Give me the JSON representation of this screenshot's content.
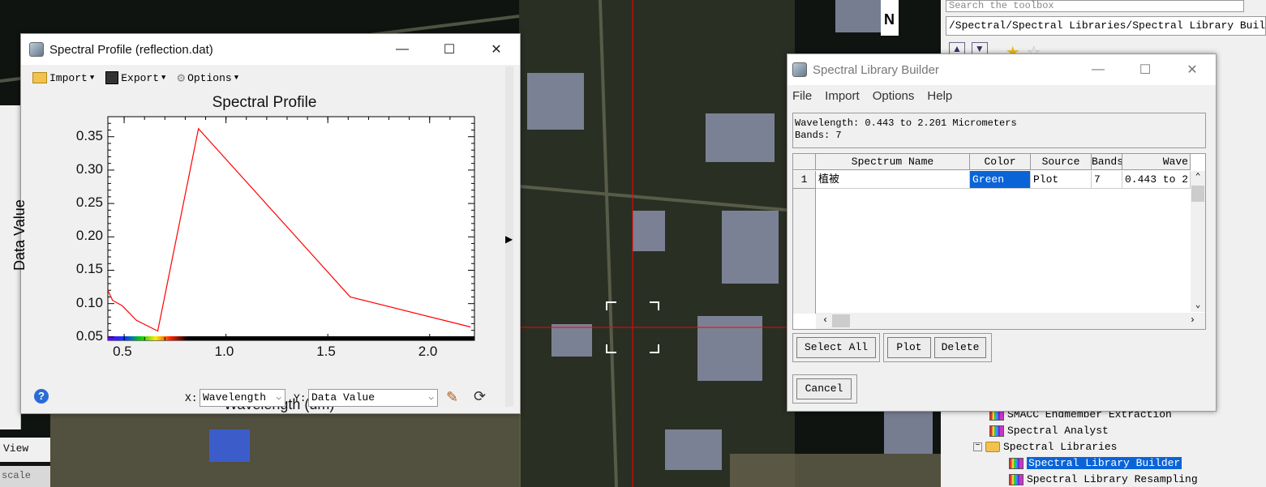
{
  "spectral_profile": {
    "title": "Spectral Profile (reflection.dat)",
    "toolbar": {
      "import": "Import",
      "export": "Export",
      "options": "Options"
    },
    "x_select": {
      "label": "X:",
      "value": "Wavelength"
    },
    "y_select": {
      "label": "Y:",
      "value": "Data Value"
    },
    "chart_data": {
      "type": "line",
      "title": "Spectral Profile",
      "xlabel": "Wavelength (um)",
      "ylabel": "Data Value",
      "xlim": [
        0.42,
        2.22
      ],
      "ylim": [
        0.045,
        0.38
      ],
      "xticks": [
        "0.5",
        "1.0",
        "1.5",
        "2.0"
      ],
      "yticks": [
        "0.05",
        "0.10",
        "0.15",
        "0.20",
        "0.25",
        "0.30",
        "0.35"
      ],
      "series": [
        {
          "color": "#ff0000",
          "x": [
            0.418,
            0.443,
            0.49,
            0.56,
            0.665,
            0.865,
            1.61,
            2.201
          ],
          "y": [
            0.12,
            0.105,
            0.097,
            0.075,
            0.059,
            0.362,
            0.11,
            0.065
          ]
        }
      ]
    }
  },
  "library_builder": {
    "title": "Spectral Library Builder",
    "menu": [
      "File",
      "Import",
      "Options",
      "Help"
    ],
    "info_line1": "Wavelength: 0.443 to 2.201 Micrometers",
    "info_line2": "Bands: 7",
    "columns": [
      "Spectrum Name",
      "Color",
      "Source",
      "Bands",
      "Wave"
    ],
    "rows": [
      {
        "num": "1",
        "name": "植被",
        "color": "Green",
        "source": "Plot",
        "bands": "7",
        "wave": "0.443 to 2."
      }
    ],
    "buttons": {
      "select_all": "Select All",
      "plot": "Plot",
      "delete": "Delete",
      "cancel": "Cancel"
    }
  },
  "toolbox": {
    "search_placeholder": "Search the toolbox",
    "path": "/Spectral/Spectral Libraries/Spectral Library Builder",
    "tree": [
      {
        "label": "SMACC Endmember Extraction"
      },
      {
        "label": "Spectral Analyst"
      },
      {
        "label": "Spectral Libraries"
      },
      {
        "label": "Spectral Library Builder"
      },
      {
        "label": "Spectral Library Resampling"
      }
    ]
  },
  "left_panel": {
    "view": "View",
    "scale": "scale"
  },
  "north_label": "N"
}
